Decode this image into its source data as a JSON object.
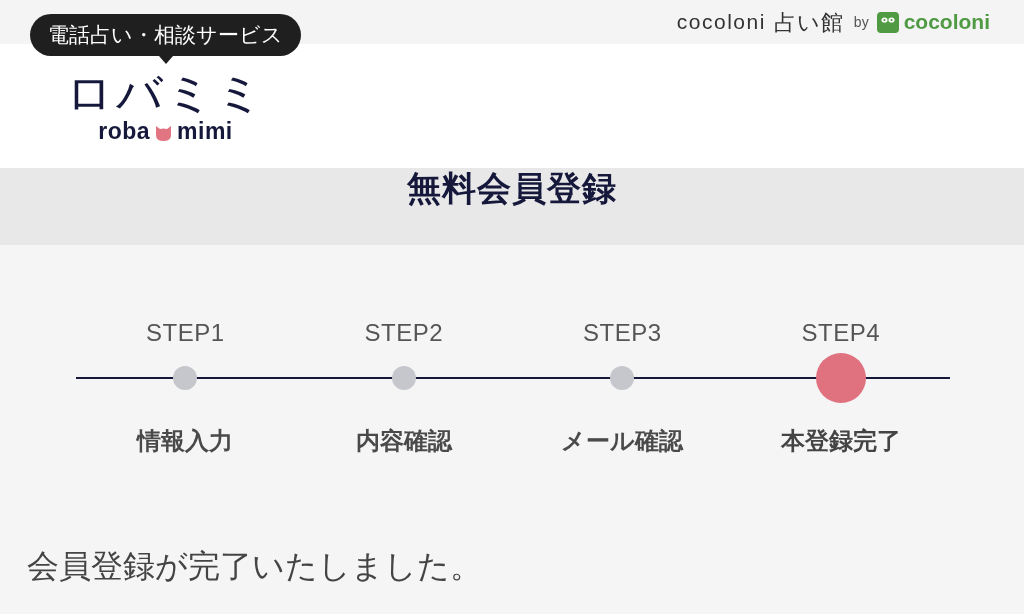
{
  "top_bar": {
    "brand": "cocoloni",
    "brand_suffix": "占い館",
    "by": "by",
    "partner": "cocoloni"
  },
  "header": {
    "tagline": "電話占い・相談サービス",
    "logo": "ロバミミ",
    "logo_roman_left": "roba",
    "logo_roman_right": "mimi"
  },
  "page_title": "無料会員登録",
  "steps": [
    {
      "label": "STEP1",
      "name": "情報入力",
      "selected": false
    },
    {
      "label": "STEP2",
      "name": "内容確認",
      "selected": false
    },
    {
      "label": "STEP3",
      "name": "メール確認",
      "selected": false
    },
    {
      "label": "STEP4",
      "name": "本登録完了",
      "selected": true
    }
  ],
  "message": "会員登録が完了いたしました。"
}
